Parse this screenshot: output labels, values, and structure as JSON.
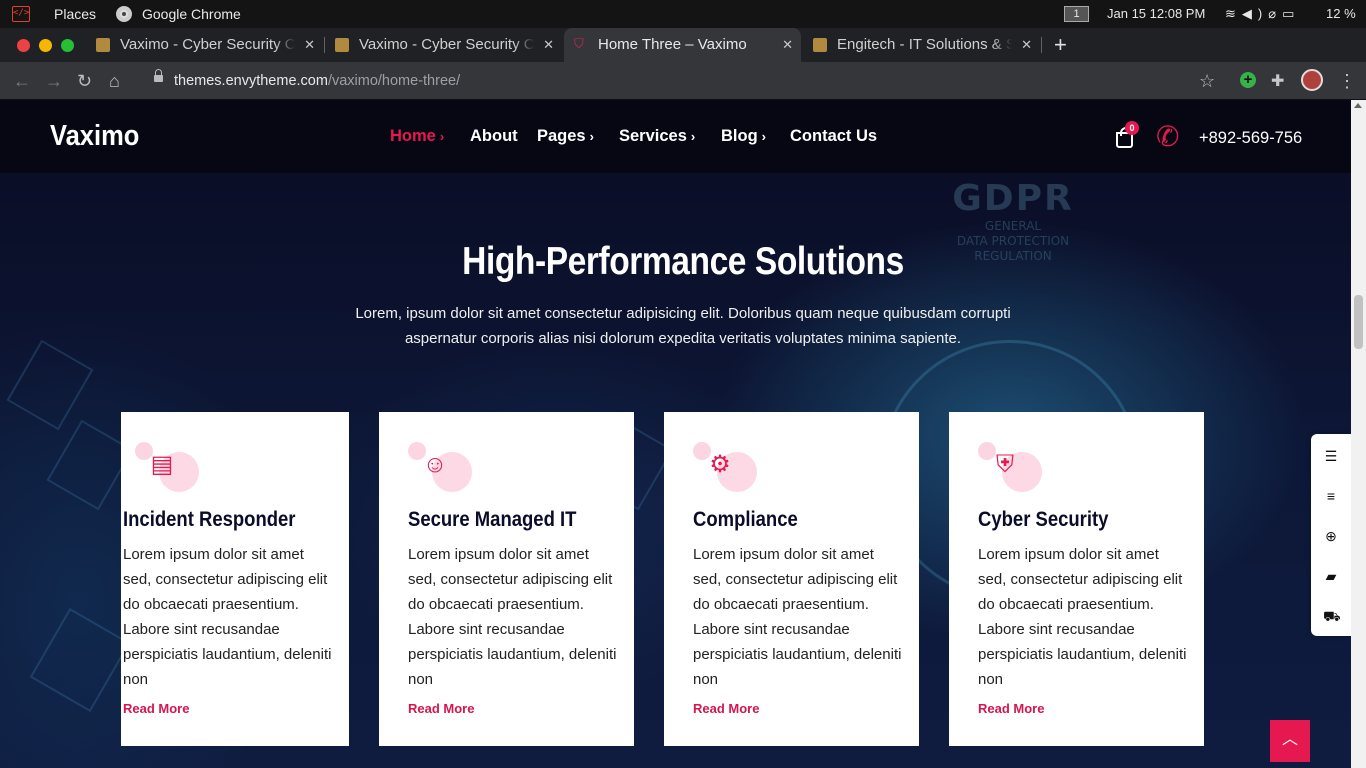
{
  "system": {
    "places": "Places",
    "app_name": "Google Chrome",
    "workspace": "1",
    "clock": "Jan 15  12:08 PM",
    "battery": "12 %"
  },
  "tabs": [
    {
      "title": "Vaximo - Cyber Security C",
      "favicon": "envytheme-icon",
      "active": false
    },
    {
      "title": "Vaximo - Cyber Security C",
      "favicon": "envytheme-icon",
      "active": false
    },
    {
      "title": "Home Three – Vaximo",
      "favicon": "shield-icon",
      "active": true
    },
    {
      "title": "Engitech - IT Solutions & S",
      "favicon": "envytheme-icon",
      "active": false
    }
  ],
  "address": {
    "domain": "themes.envytheme.com",
    "path": "/vaximo/home-three/"
  },
  "site": {
    "logo": "Vaximo",
    "menu": [
      {
        "label": "Home",
        "has_dropdown": true,
        "active": true
      },
      {
        "label": "About",
        "has_dropdown": false,
        "active": false
      },
      {
        "label": "Pages",
        "has_dropdown": true,
        "active": false
      },
      {
        "label": "Services",
        "has_dropdown": true,
        "active": false
      },
      {
        "label": "Blog",
        "has_dropdown": true,
        "active": false
      },
      {
        "label": "Contact Us",
        "has_dropdown": false,
        "active": false
      }
    ],
    "cart_count": "0",
    "phone": "+892-569-756",
    "background_text": {
      "big": "GDPR",
      "line1": "GENERAL",
      "line2": "DATA PROTECTION",
      "line3": "REGULATION"
    },
    "section": {
      "title": "High-Performance Solutions",
      "description": "Lorem, ipsum dolor sit amet consectetur adipisicing elit. Doloribus quam neque quibusdam corrupti aspernatur corporis alias nisi dolorum expedita veritatis voluptates minima sapiente."
    },
    "cards": [
      {
        "title": "Incident Responder",
        "icon": "report-icon",
        "text": "Lorem ipsum dolor sit amet sed, consectetur adipiscing elit do obcaecati praesentium. Labore sint recusandae perspiciatis laudantium, deleniti non",
        "link": "Read More"
      },
      {
        "title": "Secure Managed IT",
        "icon": "support-agent-icon",
        "text": "Lorem ipsum dolor sit amet sed, consectetur adipiscing elit do obcaecati praesentium. Labore sint recusandae perspiciatis laudantium, deleniti non",
        "link": "Read More"
      },
      {
        "title": "Compliance",
        "icon": "gear-icon",
        "text": "Lorem ipsum dolor sit amet sed, consectetur adipiscing elit do obcaecati praesentium. Labore sint recusandae perspiciatis laudantium, deleniti non",
        "link": "Read More"
      },
      {
        "title": "Cyber Security",
        "icon": "shield-virus-icon",
        "text": "Lorem ipsum dolor sit amet sed, consectetur adipiscing elit do obcaecati praesentium. Labore sint recusandae perspiciatis laudantium, deleniti non",
        "link": "Read More"
      }
    ],
    "floating_tools": [
      "align-left-icon",
      "align-right-icon",
      "lifebuoy-icon",
      "book-icon",
      "cart-icon"
    ]
  },
  "colors": {
    "accent": "#e5194f",
    "card_bg": "#ffffff",
    "header_bg": "#070714"
  }
}
